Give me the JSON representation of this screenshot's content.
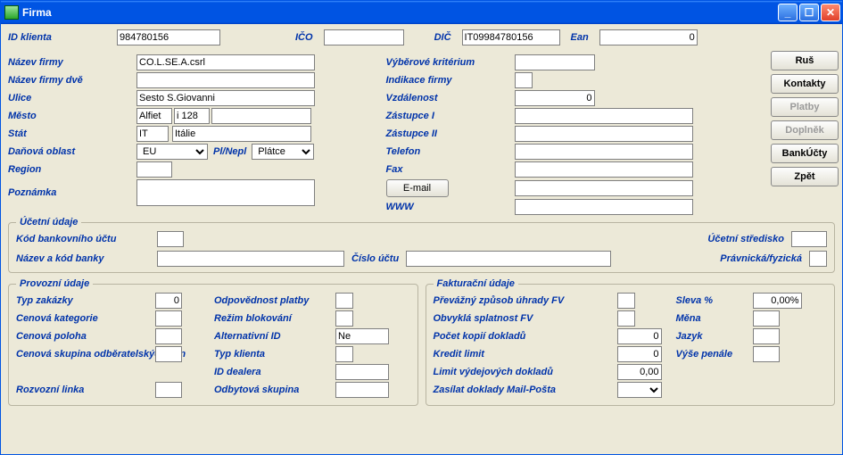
{
  "window": {
    "title": "Firma"
  },
  "header": {
    "id_label": "ID klienta",
    "id_value": "984780156",
    "ico_label": "IČO",
    "ico_value": "",
    "dic_label": "DIČ",
    "dic_value": "IT09984780156",
    "ean_label": "Ean",
    "ean_value": "0"
  },
  "main": {
    "company_name_label": "Název firmy",
    "company_name": "CO.L.SE.A.csrl",
    "company_name2_label": "Název firmy dvě",
    "company_name2": "",
    "street_label": "Ulice",
    "street": "Sesto S.Giovanni",
    "city_label": "Město",
    "city_a": "Alfiet",
    "city_b": "i 128",
    "city_c": "",
    "state_label": "Stát",
    "state_code": "IT",
    "state_name": "Itálie",
    "tax_area_label": "Daňová oblast",
    "tax_area": "EU",
    "payer_label": "Pl/Nepl",
    "payer": "Plátce",
    "region_label": "Region",
    "region": "",
    "note_label": "Poznámka",
    "note": "",
    "selcrit_label": "Výběrové kritérium",
    "selcrit": "",
    "indfirm_label": "Indikace firmy",
    "indfirm": "",
    "distance_label": "Vzdálenost",
    "distance": "0",
    "rep1_label": "Zástupce I",
    "rep1": "",
    "rep2_label": "Zástupce II",
    "rep2": "",
    "phone_label": "Telefon",
    "phone": "",
    "fax_label": "Fax",
    "fax": "",
    "email_btn": "E-mail",
    "email": "",
    "www_label": "WWW",
    "www": ""
  },
  "sidebar": {
    "cancel": "Ruš",
    "contacts": "Kontakty",
    "payments": "Platby",
    "addon": "Doplněk",
    "bankaccts": "BankÚčty",
    "back": "Zpět"
  },
  "acct": {
    "legend": "Účetní údaje",
    "bankcode_label": "Kód bankovního účtu",
    "bankcode": "",
    "center_label": "Účetní středisko",
    "center": "",
    "bankname_label": "Název a kód banky",
    "bankname": "",
    "acctnum_label": "Číslo účtu",
    "acctnum": "",
    "legal_label": "Právnická/fyzická",
    "legal": ""
  },
  "oper": {
    "legend": "Provozní údaje",
    "order_type_label": "Typ zakázky",
    "order_type": "0",
    "pay_resp_label": "Odpovědnost platby",
    "pay_resp": "",
    "price_cat_label": "Cenová kategorie",
    "price_cat": "",
    "block_mode_label": "Režim blokování",
    "block_mode": "",
    "price_pos_label": "Cenová poloha",
    "price_pos": "",
    "alt_id_label": "Alternativní ID",
    "alt_id": "Ne",
    "price_group_label": "Cenová skupina odběratelských cen",
    "price_group": "",
    "client_type_label": "Typ klienta",
    "client_type": "",
    "dealer_id_label": "ID dealera",
    "dealer_id": "",
    "delivery_line_label": "Rozvozní linka",
    "delivery_line": "",
    "sales_group_label": "Odbytová skupina",
    "sales_group": ""
  },
  "inv": {
    "legend": "Fakturační údaje",
    "pay_method_label": "Převážný způsob úhrady FV",
    "pay_method": "",
    "discount_label": "Sleva %",
    "discount": "0,00%",
    "due_label": "Obvyklá splatnost FV",
    "due": "",
    "currency_label": "Měna",
    "currency": "",
    "copies_label": "Počet kopií dokladů",
    "copies": "0",
    "lang_label": "Jazyk",
    "lang": "",
    "credit_limit_label": "Kredit limit",
    "credit_limit": "0",
    "penalty_label": "Výše penále",
    "penalty": "",
    "issue_limit_label": "Limit výdejových dokladů",
    "issue_limit": "0,00",
    "send_docs_label": "Zasílat doklady Mail-Pošta",
    "send_docs": ""
  }
}
